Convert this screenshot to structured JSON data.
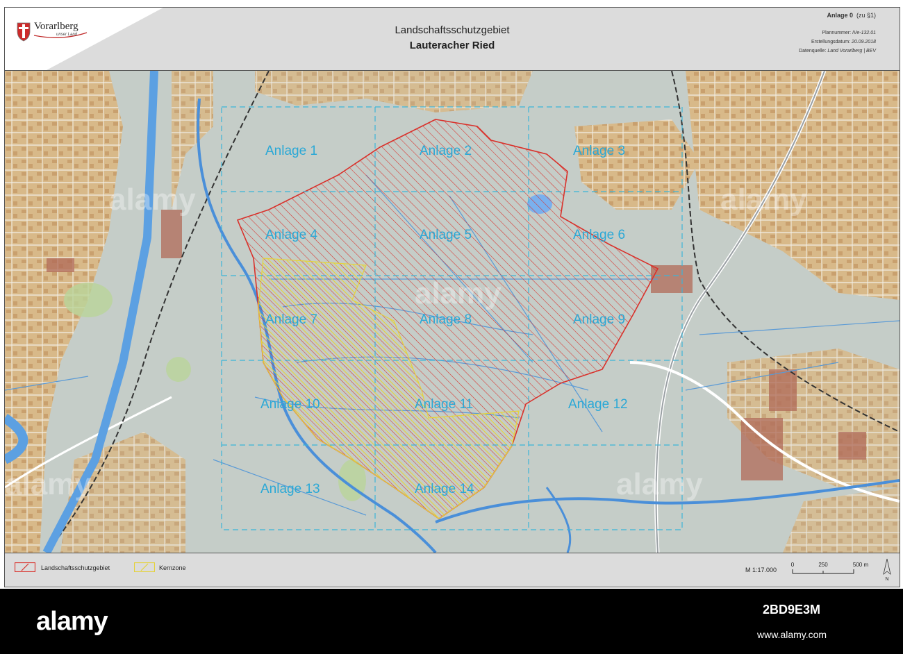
{
  "header": {
    "logo_text": "Vorarlberg",
    "logo_sub": "unser Land",
    "title_line1": "Landschaftsschutzgebiet",
    "title_line2": "Lauteracher Ried",
    "anlage_label": "Anlage 0",
    "anlage_ref": "(zu §1)",
    "plan_label": "Plannummer:",
    "plan_value": "IVe-132.01",
    "date_label": "Erstellungsdatum:",
    "date_value": "20.09.2018",
    "source_label": "Datenquelle:",
    "source_value": "Land Vorarlberg | BEV"
  },
  "map": {
    "anlage_labels": [
      "Anlage 1",
      "Anlage 2",
      "Anlage 3",
      "Anlage 4",
      "Anlage 5",
      "Anlage 6",
      "Anlage 7",
      "Anlage 8",
      "Anlage 9",
      "Anlage 10",
      "Anlage 11",
      "Anlage 12",
      "Anlage 13",
      "Anlage 14"
    ],
    "watermark": "alamy",
    "colors": {
      "protected_area": "#d9312b",
      "core_zone": "#e5d23a",
      "grid": "#3bb5d8",
      "river": "#4a8fd9",
      "settlement": "#d9b27c",
      "land": "#c4ccc8"
    }
  },
  "legend": {
    "items": [
      {
        "label": "Landschaftsschutzgebiet",
        "color": "#d9312b"
      },
      {
        "label": "Kernzone",
        "color": "#e5d23a"
      }
    ],
    "scale_label": "M 1:17.000",
    "scale_ticks": [
      "0",
      "250",
      "500 m"
    ],
    "north_label": "N"
  },
  "stock_bar": {
    "logo": "alamy",
    "image_id": "2BD9E3M",
    "url": "www.alamy.com"
  }
}
